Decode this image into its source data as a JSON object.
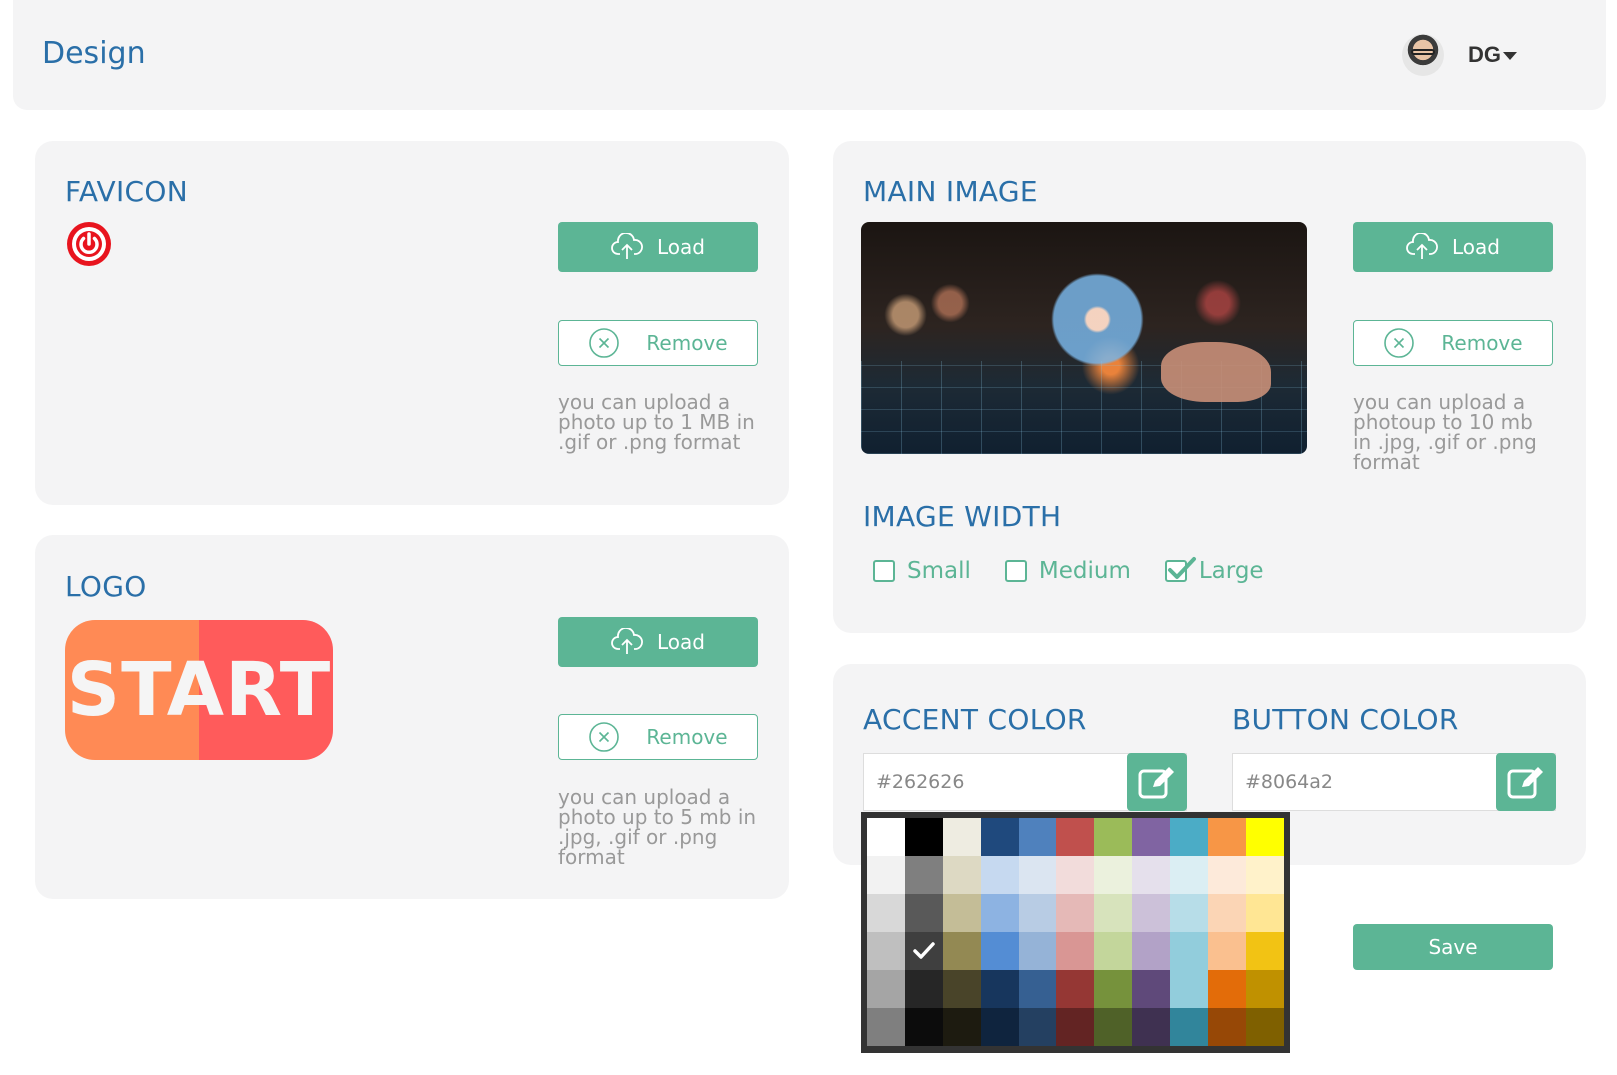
{
  "header": {
    "title": "Design",
    "user_initials": "DG"
  },
  "favicon": {
    "title": "FAVICON",
    "load_label": "Load",
    "remove_label": "Remove",
    "hint": "you can upload a photo up to 1 MB in .gif or .png format"
  },
  "logo": {
    "title": "LOGO",
    "logo_text": "START",
    "load_label": "Load",
    "remove_label": "Remove",
    "hint": "you can upload a photo up to 5 mb in .jpg, .gif or .png format"
  },
  "main_image": {
    "title": "MAIN IMAGE",
    "load_label": "Load",
    "remove_label": "Remove",
    "hint": "you can upload a photoup to 10 mb in .jpg, .gif or .png format"
  },
  "image_width": {
    "title": "IMAGE WIDTH",
    "options": [
      {
        "label": "Small",
        "checked": false
      },
      {
        "label": "Medium",
        "checked": false
      },
      {
        "label": "Large",
        "checked": true
      }
    ]
  },
  "accent_color": {
    "title": "ACCENT COLOR",
    "value": "#262626"
  },
  "button_color": {
    "title": "BUTTON COLOR",
    "value": "#8064a2"
  },
  "palette": {
    "selected": "#3f3f3f",
    "rows": [
      [
        "#ffffff",
        "#000000",
        "#eeece1",
        "#1f497d",
        "#4f81bd",
        "#c0504d",
        "#9bbb59",
        "#8064a2",
        "#4bacc6",
        "#f79646",
        "#ffff00"
      ],
      [
        "#f2f2f2",
        "#7f7f7f",
        "#ddd9c3",
        "#c6d9f0",
        "#dbe5f1",
        "#f2dcdb",
        "#ebf1dd",
        "#e5e0ec",
        "#dbeef3",
        "#fdeada",
        "#fff2ca"
      ],
      [
        "#d8d8d8",
        "#595959",
        "#c4bd97",
        "#8db3e2",
        "#b8cce4",
        "#e5b9b7",
        "#d7e3bc",
        "#ccc1d9",
        "#b7dde8",
        "#fbd5b5",
        "#ffe694"
      ],
      [
        "#bfbfbf",
        "#3f3f3f",
        "#938953",
        "#548dd4",
        "#95b3d7",
        "#d99694",
        "#c3d69b",
        "#b2a2c7",
        "#92cddc",
        "#fac08f",
        "#f2c314"
      ],
      [
        "#a5a5a5",
        "#262626",
        "#494429",
        "#17365d",
        "#366092",
        "#953734",
        "#76923c",
        "#5f497a",
        "#92cddc",
        "#e36c09",
        "#c09100"
      ],
      [
        "#7f7f7f",
        "#0c0c0c",
        "#1d1b10",
        "#0f243e",
        "#244061",
        "#632423",
        "#4f6128",
        "#3f3151",
        "#31859b",
        "#974806",
        "#7f6000"
      ]
    ]
  },
  "save_label": "Save",
  "colors": {
    "accent": "#5cb595",
    "title": "#2a6fa8",
    "card": "#f4f4f5"
  }
}
